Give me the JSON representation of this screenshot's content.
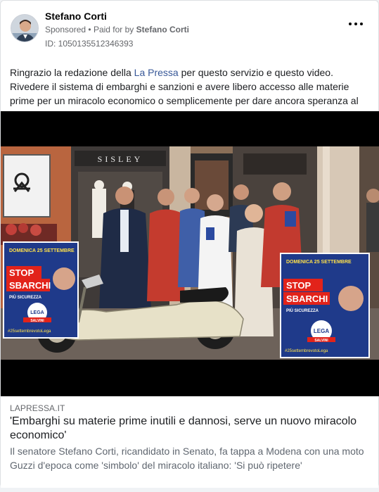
{
  "post": {
    "author": "Stefano Corti",
    "sponsored_label": "Sponsored",
    "separator": "•",
    "paid_for_prefix": "Paid for by",
    "paid_for_by": "Stefano Corti",
    "ad_id": "ID: 1050135512346393",
    "more_icon": "more-horizontal-icon",
    "text_before_link": "Ringrazio la redazione della ",
    "text_link": "La Pressa",
    "text_after_link": " per questo servizio e questo video. Rivedere il sistema di embarghi e sanzioni e avere libero accesso alle materie prime per un miracolo economico o semplicemente per dare ancora speranza al nostro Paese."
  },
  "video": {
    "storefront_sign": "SISLEY",
    "poster_left": {
      "date": "DOMENICA 25 SETTEMBRE",
      "headline_1": "STOP",
      "headline_2": "SBARCHI",
      "subline": "PIÙ SICUREZZA",
      "logo": "LEGA",
      "logo_sub": "SALVINI",
      "hashtag": "#25settembrevotoLega"
    },
    "poster_right": {
      "date": "DOMENICA 25 SETTEMBRE",
      "headline_1": "STOP",
      "headline_2": "SBARCHI",
      "subline": "PIÙ SICUREZZA",
      "logo": "LEGA",
      "logo_sub": "SALVINI",
      "hashtag": "#25settembrevotoLega"
    }
  },
  "link_preview": {
    "domain": "LAPRESSA.IT",
    "title": "'Embarghi su materie prime inutili e dannosi, serve un nuovo miracolo economico'",
    "description": "Il senatore Stefano Corti, ricandidato in Senato, fa tappa a Modena con una moto Guzzi d'epoca come 'simbolo' del miracolo italiano: 'Si può ripetere'"
  },
  "colors": {
    "link_blue": "#385898",
    "secondary_text": "#65676b",
    "poster_red": "#e2231a",
    "poster_blue": "#1f3a8a"
  }
}
